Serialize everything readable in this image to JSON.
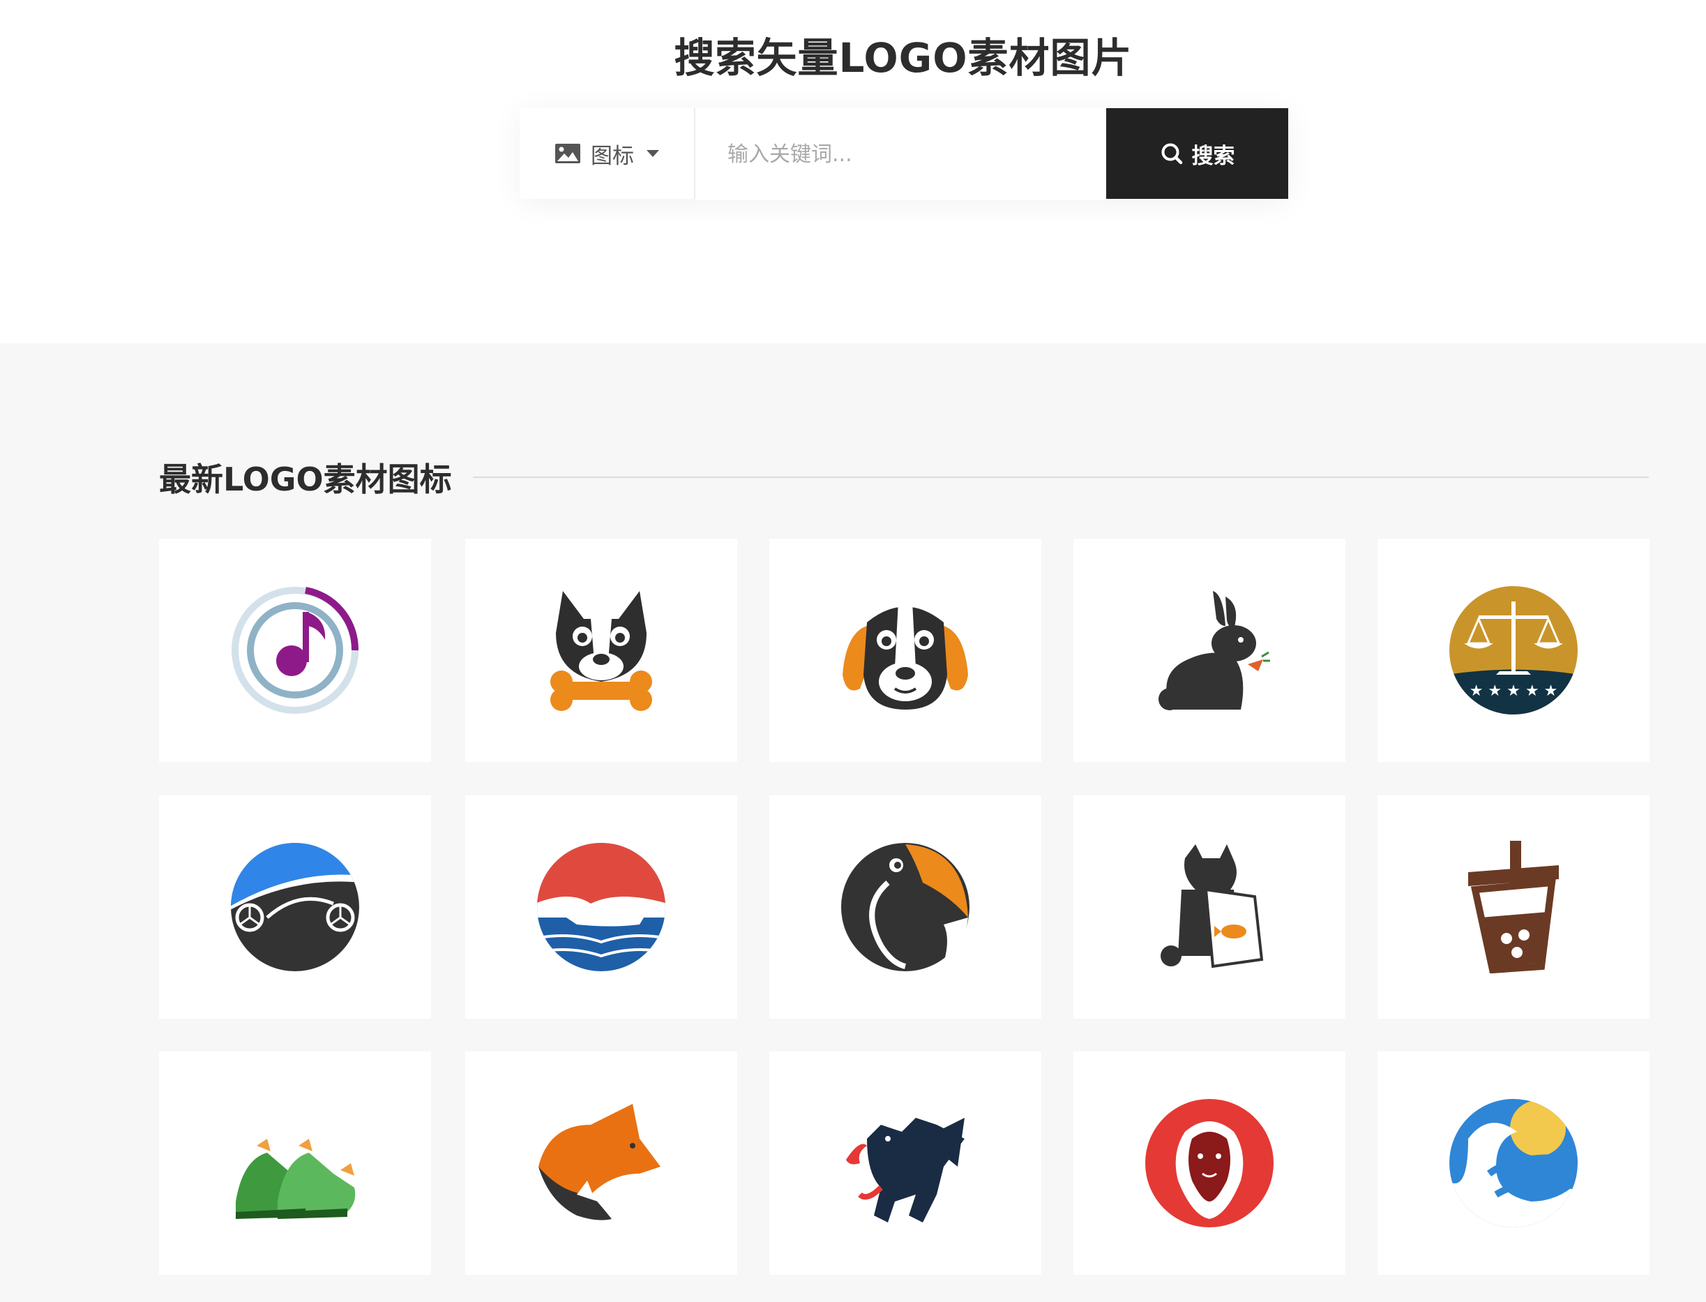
{
  "hero": {
    "title": "搜索矢量LOGO素材图片",
    "search": {
      "type_label": "图标",
      "placeholder": "输入关键词...",
      "button_label": "搜索"
    }
  },
  "section": {
    "title": "最新LOGO素材图标"
  },
  "logos": [
    {
      "icon": "music-note-circle-icon"
    },
    {
      "icon": "dog-with-bone-icon"
    },
    {
      "icon": "beagle-dog-icon"
    },
    {
      "icon": "rabbit-with-carrot-icon"
    },
    {
      "icon": "justice-scales-icon"
    },
    {
      "icon": "car-circle-icon"
    },
    {
      "icon": "sea-turtle-icon"
    },
    {
      "icon": "toucan-bird-icon"
    },
    {
      "icon": "cat-with-fish-bag-icon"
    },
    {
      "icon": "bubble-tea-icon"
    },
    {
      "icon": "green-sneakers-icon"
    },
    {
      "icon": "fox-head-icon"
    },
    {
      "icon": "dragon-icon"
    },
    {
      "icon": "lion-red-sun-icon"
    },
    {
      "icon": "swan-waves-icon"
    }
  ],
  "colors": {
    "button_bg": "#222222",
    "gallery_bg": "#f7f7f7",
    "orange": "#ec8a1c",
    "red": "#e04a3e",
    "blue": "#2f7fd6"
  }
}
